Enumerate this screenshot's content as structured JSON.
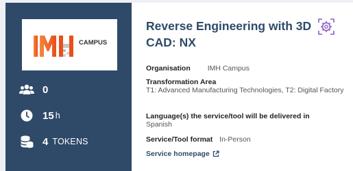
{
  "provider": {
    "logo_text_left": "IMH",
    "logo_text_right": "CAMPUS"
  },
  "stats": {
    "participants": "0",
    "hours": "15",
    "hours_unit": "h",
    "tokens": "4",
    "tokens_unit": "TOKENS"
  },
  "service": {
    "title": "Reverse Engineering with 3D CAD: NX",
    "organisation_label": "Organisation",
    "organisation_value": "IMH Campus",
    "transformation_label": "Transformation Area",
    "transformation_value": "T1: Advanced Manufacturing Technologies, T2: Digital Factory",
    "language_label": "Language(s) the service/tool will be delivered in",
    "language_value": "Spanish",
    "format_label": "Service/Tool format",
    "format_value": "In-Person",
    "homepage_label": "Service homepage"
  },
  "icons": {
    "participants": "users-icon",
    "hours": "clock-icon",
    "tokens": "coins-icon",
    "badge": "gear-badge-icon",
    "external": "external-link-icon"
  },
  "colors": {
    "sidebar": "#2f4a68",
    "title": "#2f4a68",
    "badge": "#8a5bc8",
    "logo_orange": "#f26a21"
  }
}
